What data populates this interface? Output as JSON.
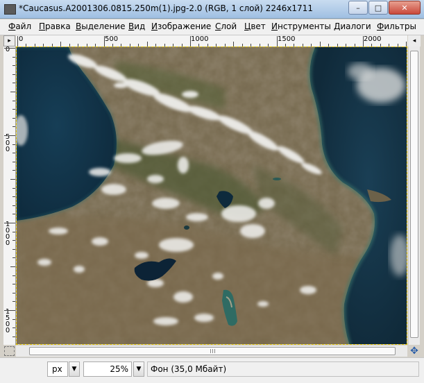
{
  "window": {
    "title": "*Caucasus.A2001306.0815.250m(1).jpg-2.0 (RGB, 1 слой) 2246x1711",
    "minimize_glyph": "–",
    "maximize_glyph": "□",
    "close_glyph": "✕"
  },
  "menu": {
    "items": [
      {
        "underline": "Ф",
        "rest": "айл"
      },
      {
        "underline": "П",
        "rest": "равка"
      },
      {
        "underline": "В",
        "rest": "ыделение"
      },
      {
        "underline": "В",
        "rest": "ид"
      },
      {
        "underline": "И",
        "rest": "зображение"
      },
      {
        "underline": "С",
        "rest": "лой"
      },
      {
        "underline": "Ц",
        "rest": "вет"
      },
      {
        "underline": "И",
        "rest": "нструменты"
      },
      {
        "underline": "Д",
        "rest": "иалоги"
      },
      {
        "underline": "Ф",
        "rest": "ильтры"
      }
    ]
  },
  "rulers": {
    "horizontal_labels": [
      "0",
      "500",
      "1000",
      "1500",
      "2000"
    ],
    "vertical_labels": [
      "0",
      "500",
      "1000",
      "1500"
    ],
    "corner_glyph": "▸",
    "nav_glyph": "◂"
  },
  "status": {
    "unit": "px",
    "unit_arrow": "▼",
    "zoom": "25%",
    "zoom_arrow": "▼",
    "layer_info": "Фон (35,0 Мбайт)"
  },
  "icons": {
    "navigate": "✥"
  },
  "colors": {
    "sea": "#12334a",
    "land": "#6d6047",
    "snow": "#f2f2f0",
    "selection_border": "#e8c800"
  }
}
